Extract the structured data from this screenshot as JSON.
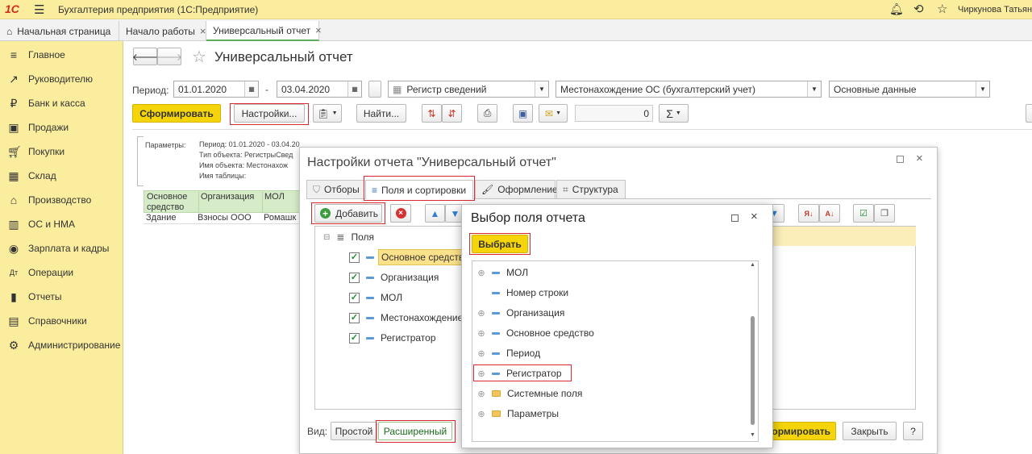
{
  "titlebar": {
    "app_title": "Бухгалтерия предприятия (1С:Предприятие)",
    "user": "Чиркунова Татьяна А"
  },
  "tabs": [
    {
      "label": "Начальная страница"
    },
    {
      "label": "Начало работы"
    },
    {
      "label": "Универсальный отчет"
    }
  ],
  "sidebar": {
    "items": [
      {
        "label": "Главное"
      },
      {
        "label": "Руководителю"
      },
      {
        "label": "Банк и касса"
      },
      {
        "label": "Продажи"
      },
      {
        "label": "Покупки"
      },
      {
        "label": "Склад"
      },
      {
        "label": "Производство"
      },
      {
        "label": "ОС и НМА"
      },
      {
        "label": "Зарплата и кадры"
      },
      {
        "label": "Операции"
      },
      {
        "label": "Отчеты"
      },
      {
        "label": "Справочники"
      },
      {
        "label": "Администрирование"
      }
    ]
  },
  "report": {
    "title": "Универсальный отчет",
    "period_label": "Период:",
    "date_from": "01.01.2020",
    "date_sep": "-",
    "date_to": "03.04.2020",
    "object_type": "Регистр сведений",
    "object_name": "Местонахождение ОС (бухгалтерский учет)",
    "table_name": "Основные данные",
    "generate_label": "Сформировать",
    "settings_label": "Настройки...",
    "find_label": "Найти...",
    "sum_value": "0",
    "params_label": "Параметры:",
    "param_period": "Период: 01.01.2020 - 03.04.20",
    "param_type": "Тип объекта: РегистрыСвед",
    "param_name": "Имя объекта: Местонахож",
    "param_table": "Имя таблицы:",
    "columns": [
      "Основное средство",
      "Организация",
      "МОЛ"
    ],
    "row": [
      "Здание",
      "Взносы ООО",
      "Ромашк"
    ]
  },
  "settings_dialog": {
    "title": "Настройки отчета \"Универсальный отчет\"",
    "tabs": [
      "Отборы",
      "Поля и сортировки",
      "Оформление",
      "Структура"
    ],
    "add_label": "Добавить",
    "tree_root": "Поля",
    "fields": [
      "Основное средство",
      "Организация",
      "МОЛ",
      "Местонахождение",
      "Регистратор"
    ],
    "view_label": "Вид:",
    "simple_label": "Простой",
    "extended_label": "Расширенный",
    "generate_label": "Сформировать",
    "close_label": "Закрыть",
    "help_label": "?"
  },
  "select_dialog": {
    "title": "Выбор поля отчета",
    "select_label": "Выбрать",
    "items": [
      {
        "label": "МОЛ",
        "kind": "field",
        "expandable": true
      },
      {
        "label": "Номер строки",
        "kind": "field",
        "expandable": false
      },
      {
        "label": "Организация",
        "kind": "field",
        "expandable": true
      },
      {
        "label": "Основное средство",
        "kind": "field",
        "expandable": true
      },
      {
        "label": "Период",
        "kind": "field",
        "expandable": true
      },
      {
        "label": "Регистратор",
        "kind": "field",
        "expandable": true
      },
      {
        "label": "Системные поля",
        "kind": "folder",
        "expandable": true
      },
      {
        "label": "Параметры",
        "kind": "folder",
        "expandable": true
      }
    ]
  },
  "colors": {
    "accent_yellow": "#f5d50a",
    "panel_yellow": "#fbed9e",
    "highlight_red": "#d9282f",
    "check_green": "#1f8c2f"
  }
}
